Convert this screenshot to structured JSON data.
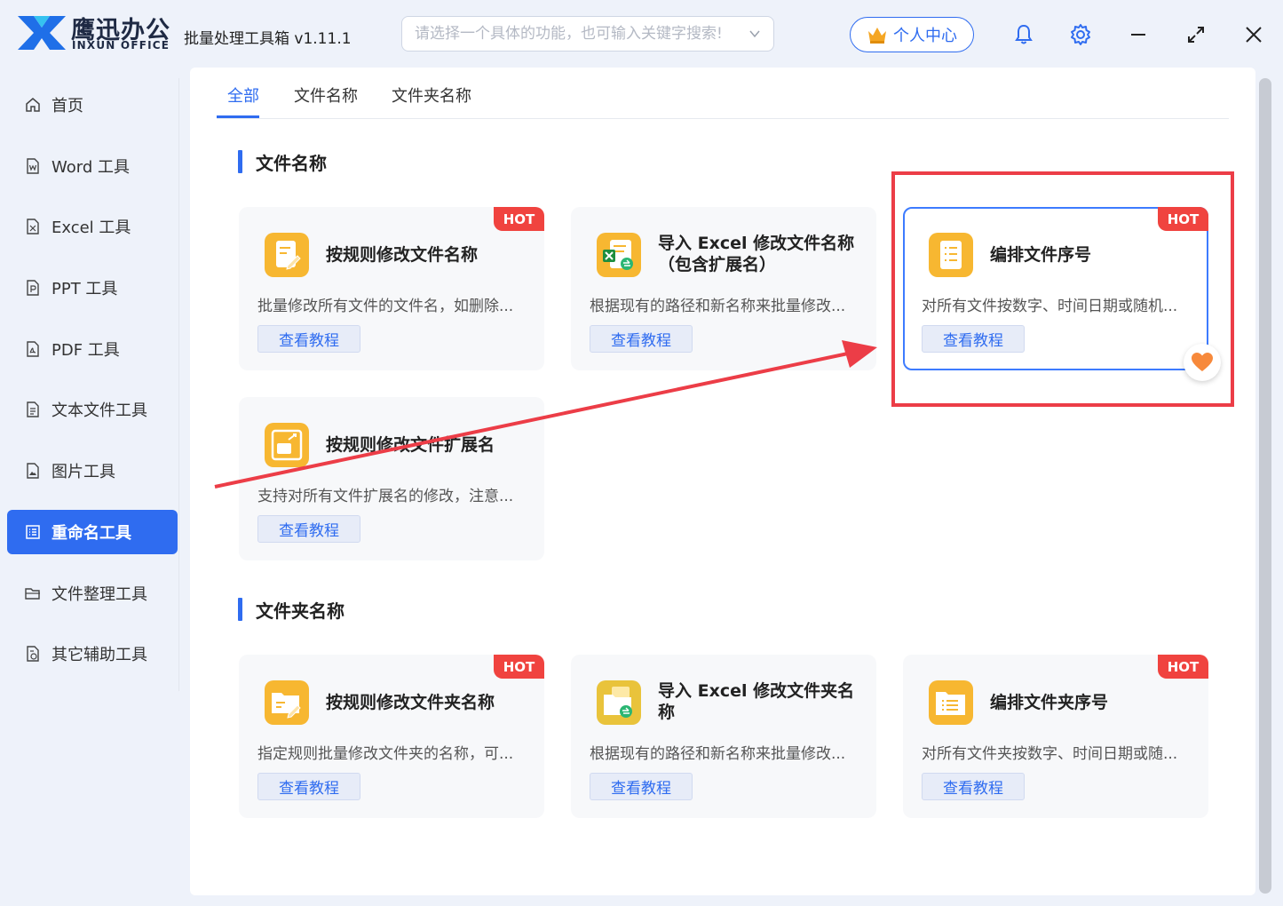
{
  "brand": {
    "name_cn": "鹰迅办公",
    "name_en": "INXUN OFFICE"
  },
  "app_title": "批量处理工具箱 v1.11.1",
  "search": {
    "placeholder": "请选择一个具体的功能，也可输入关键字搜索!"
  },
  "header": {
    "user_center_label": "个人中心"
  },
  "sidebar": {
    "items": [
      {
        "label": "首页",
        "icon": "home-icon"
      },
      {
        "label": "Word 工具",
        "icon": "word-file-icon"
      },
      {
        "label": "Excel 工具",
        "icon": "excel-file-icon"
      },
      {
        "label": "PPT 工具",
        "icon": "ppt-file-icon"
      },
      {
        "label": "PDF 工具",
        "icon": "pdf-file-icon"
      },
      {
        "label": "文本文件工具",
        "icon": "text-file-icon"
      },
      {
        "label": "图片工具",
        "icon": "image-file-icon"
      },
      {
        "label": "重命名工具",
        "icon": "rename-icon",
        "active": true
      },
      {
        "label": "文件整理工具",
        "icon": "folder-icon"
      },
      {
        "label": "其它辅助工具",
        "icon": "tools-icon"
      }
    ]
  },
  "tabs": [
    {
      "label": "全部",
      "active": true
    },
    {
      "label": "文件名称"
    },
    {
      "label": "文件夹名称"
    }
  ],
  "sections": [
    {
      "title": "文件名称",
      "cards": [
        {
          "title": "按规则修改文件名称",
          "desc": "批量修改所有文件的文件名，如删除...",
          "button": "查看教程",
          "hot": "HOT"
        },
        {
          "title": "导入 Excel 修改文件名称（包含扩展名）",
          "desc": "根据现有的路径和新名称来批量修改...",
          "button": "查看教程"
        },
        {
          "title": "编排文件序号",
          "desc": "对所有文件按数字、时间日期或随机...",
          "button": "查看教程",
          "hot": "HOT",
          "selected": true
        },
        {
          "title": "按规则修改文件扩展名",
          "desc": "支持对所有文件扩展名的修改，注意...",
          "button": "查看教程"
        }
      ]
    },
    {
      "title": "文件夹名称",
      "cards": [
        {
          "title": "按规则修改文件夹名称",
          "desc": "指定规则批量修改文件夹的名称，可...",
          "button": "查看教程",
          "hot": "HOT"
        },
        {
          "title": "导入 Excel 修改文件夹名称",
          "desc": "根据现有的路径和新名称来批量修改...",
          "button": "查看教程"
        },
        {
          "title": "编排文件夹序号",
          "desc": "对所有文件夹按数字、时间日期或随...",
          "button": "查看教程",
          "hot": "HOT"
        }
      ]
    }
  ],
  "colors": {
    "accent": "#2f6cf0",
    "hot": "#f0433f",
    "annotation": "#ec3d47",
    "icon_yellow": "#f7b731"
  }
}
